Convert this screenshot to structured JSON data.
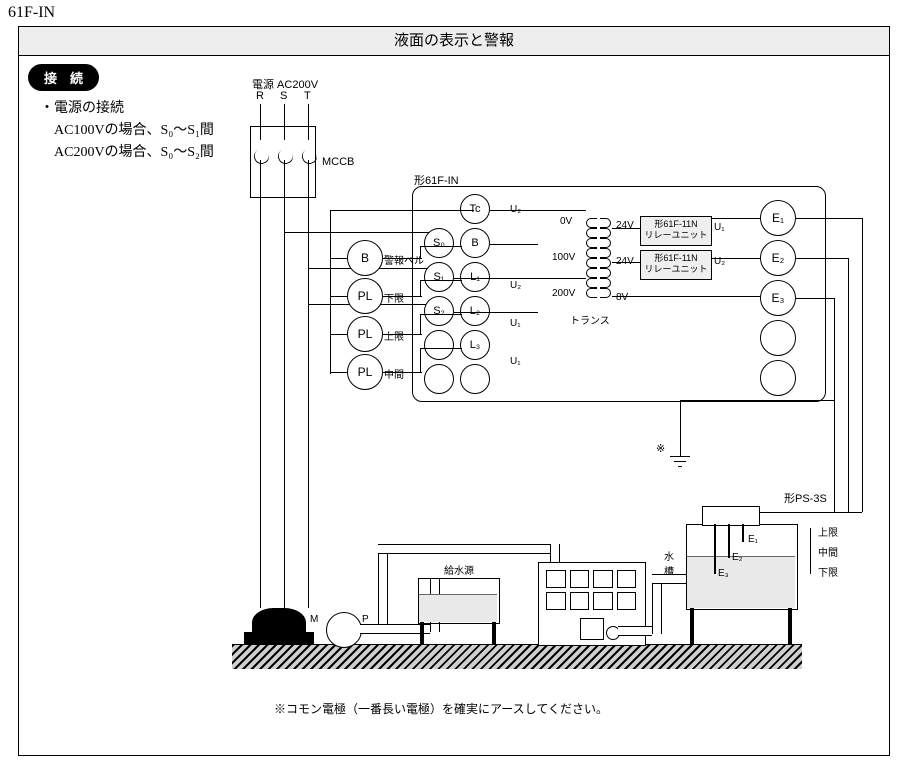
{
  "model_top": "61F-IN",
  "title": "液面の表示と警報",
  "section_label": "接　続",
  "notes": {
    "line1": "・電源の接続",
    "line2": "　AC100Vの場合、S₀〜S₁間",
    "line3": "　AC200Vの場合、S₀〜S₂間"
  },
  "power": {
    "label": "電源 AC200V",
    "phase_r": "R",
    "phase_s": "S",
    "phase_t": "T"
  },
  "mccb": "MCCB",
  "indicators": {
    "b": "B",
    "b_label": "警報ベル",
    "pl1": "PL",
    "pl1_label": "下限",
    "pl2": "PL",
    "pl2_label": "上限",
    "pl3": "PL",
    "pl3_label": "中間"
  },
  "unit_label": "形61F-IN",
  "terminals_left": {
    "tc": "Tc",
    "s0": "S₀",
    "b": "B",
    "s1": "S₁",
    "l1": "L₁",
    "s2": "S₂",
    "l2": "L₂",
    "l3": "L₃"
  },
  "inner_taps": {
    "u1": "U₁",
    "u2": "U₂",
    "v0": "0V",
    "v100": "100V",
    "v200": "200V",
    "v24": "24V",
    "v8": "8V"
  },
  "trans_label": "トランス",
  "relay": {
    "name": "形61F-11N",
    "sub": "リレーユニット"
  },
  "terminals_right": {
    "e1": "E₁",
    "e2": "E₂",
    "e3": "E₃"
  },
  "electrode_unit": "形PS-3S",
  "tank_label": "水\n槽",
  "levels": {
    "hi": "上限",
    "mid": "中間",
    "lo": "下限"
  },
  "electrodes": {
    "e1": "E₁",
    "e2": "E₂",
    "e3": "E₃"
  },
  "pump": {
    "m": "M",
    "p": "P"
  },
  "supply": "給水源",
  "ground_mark": "※",
  "footnote": "※コモン電極（一番長い電極）を確実にアースしてください。"
}
